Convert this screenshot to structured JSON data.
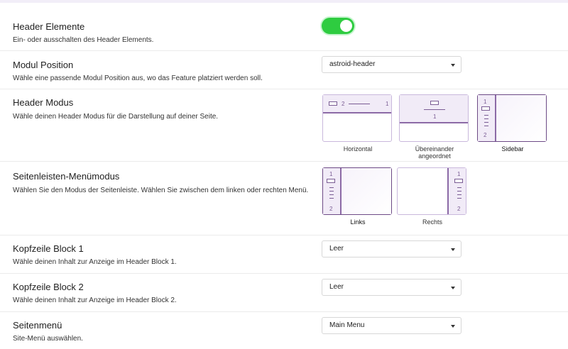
{
  "header_elements": {
    "label": "Header Elemente",
    "description": "Ein- oder ausschalten des Header Elements.",
    "enabled": true
  },
  "modul_position": {
    "label": "Modul Position",
    "description": "Wähle eine passende Modul Position aus, wo das Feature platziert werden soll.",
    "value": "astroid-header"
  },
  "header_modus": {
    "label": "Header Modus",
    "description": "Wähle deinen Header Modus für die Darstellung auf deiner Seite.",
    "options": [
      "Horizontal",
      "Übereinander angeordnet",
      "Sidebar"
    ],
    "selected": "Sidebar"
  },
  "seitenleisten_menumodus": {
    "label": "Seitenleisten-Menümodus",
    "description": "Wählen Sie den Modus der Seitenleiste. Wählen Sie zwischen dem linken oder rechten Menü.",
    "options": [
      "Links",
      "Rechts"
    ],
    "selected": "Links"
  },
  "kopfzeile_block_1": {
    "label": "Kopfzeile Block 1",
    "description": "Wähle deinen Inhalt zur Anzeige im Header Block 1.",
    "value": "Leer"
  },
  "kopfzeile_block_2": {
    "label": "Kopfzeile Block 2",
    "description": "Wähle deinen Inhalt zur Anzeige im Header Block 2.",
    "value": "Leer"
  },
  "seitenmenu": {
    "label": "Seitenmenü",
    "description": "Site-Menü auswählen.",
    "value": "Main Menu"
  },
  "thumb_marks": {
    "one": "1",
    "two": "2"
  },
  "colors": {
    "toggle_on": "#2ecc40",
    "accent": "#8c6aa6"
  }
}
